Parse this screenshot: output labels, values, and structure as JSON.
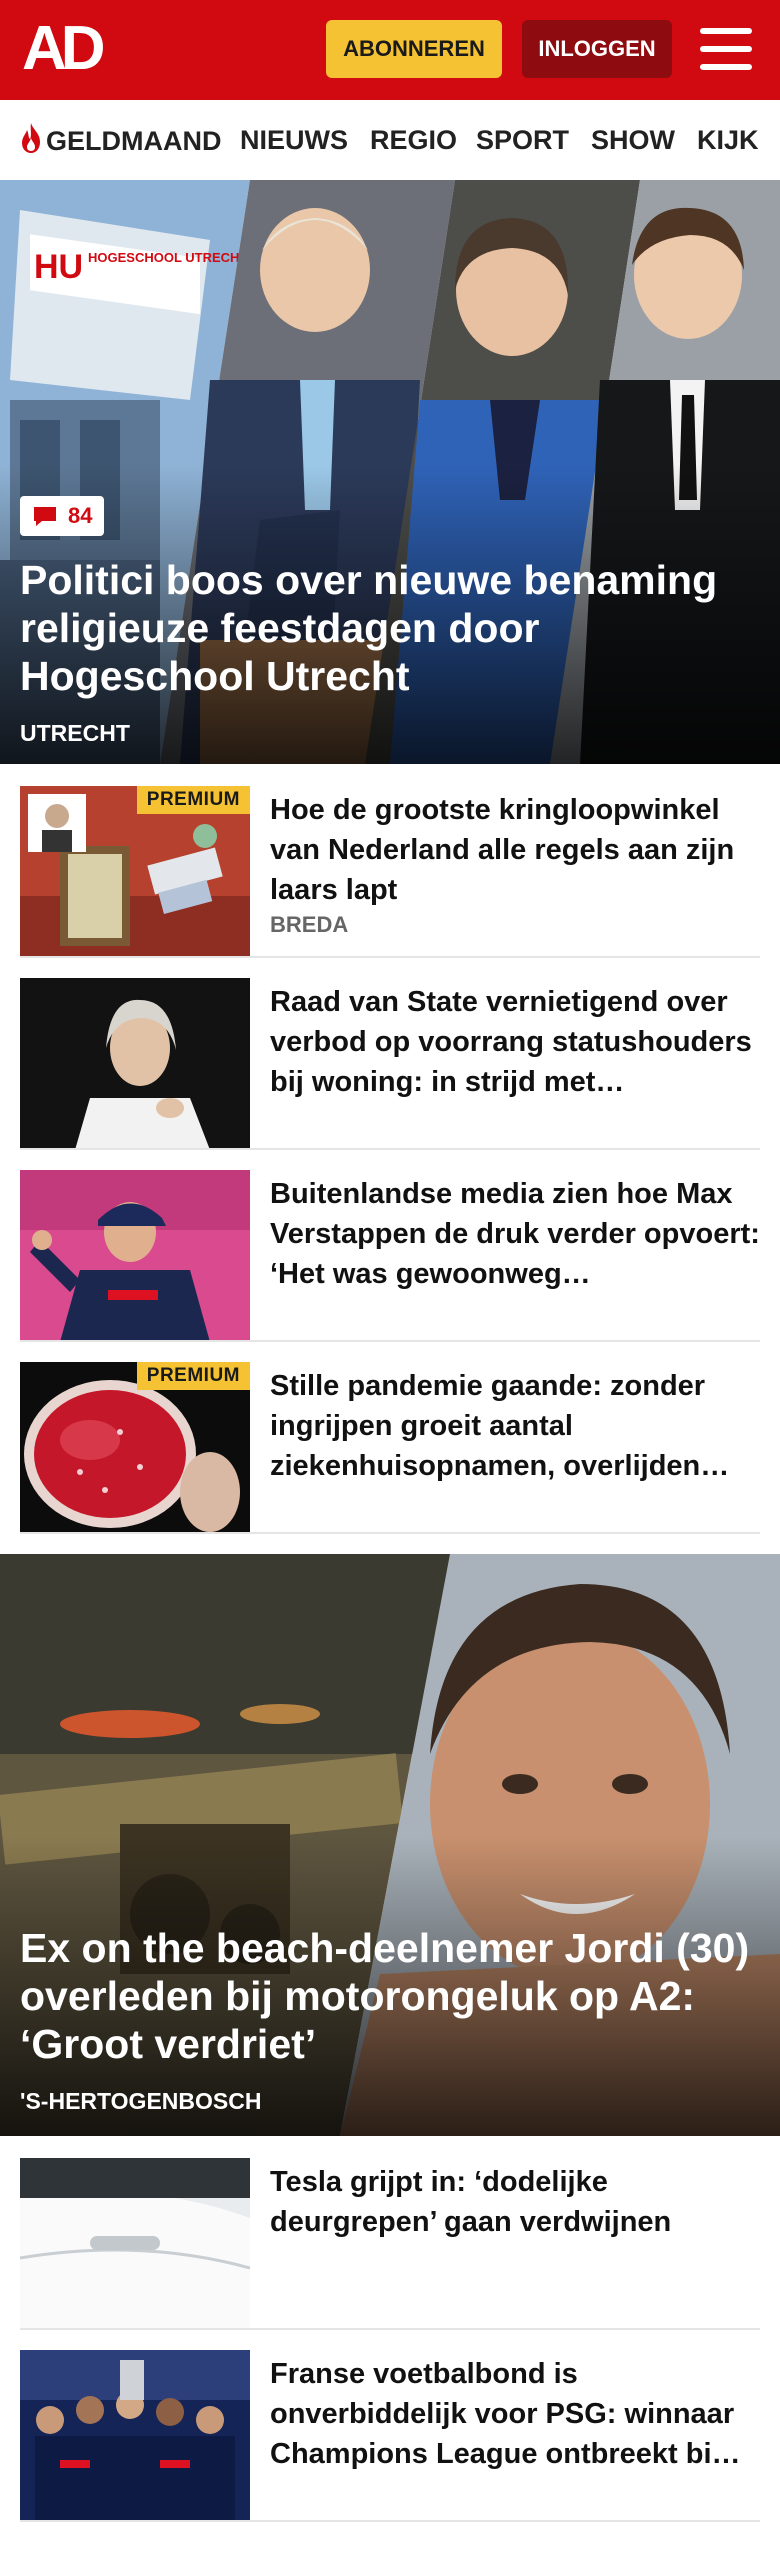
{
  "header": {
    "logo": "AD",
    "subscribe_label": "ABONNEREN",
    "login_label": "INLOGGEN"
  },
  "nav": {
    "items": [
      "GELDMAAND",
      "NIEUWS",
      "REGIO",
      "SPORT",
      "SHOW",
      "KIJK"
    ]
  },
  "hero1": {
    "comments": "84",
    "title": "Politici boos over nieuwe benaming religieuze feestdagen door Hogeschool Utrecht",
    "location": "UTRECHT",
    "sign_text": "HOGESCHOOL UTRECHT",
    "sign_logo": "HU"
  },
  "list1": [
    {
      "title": "Hoe de grootste kringloopwinkel van Nederland alle regels aan zijn laars lapt",
      "location": "BREDA",
      "badge": "PREMIUM"
    },
    {
      "title": "Raad van State vernietigend over verbod op voorrang statushou­ders bij woning: in strijd met…",
      "location": "",
      "badge": ""
    },
    {
      "title": "Buitenlandse media zien hoe Max Verstappen de druk verder opvoert: ‘Het was gewoonweg…",
      "location": "",
      "badge": ""
    },
    {
      "title": "Stille pandemie gaande: zonder ingrijpen groeit aantal ziekenhuisopnamen, overlijden…",
      "location": "",
      "badge": "PREMIUM"
    }
  ],
  "hero2": {
    "title": "Ex on the beach-deelnemer Jordi (30) overleden bij motorongeluk op A2: ‘Groot verdriet’",
    "location": "'S-HERTOGENBOSCH"
  },
  "list2": [
    {
      "title": "Tesla grijpt in: ‘dodelijke deurgrepen’ gaan verdwijnen"
    },
    {
      "title": "Franse voetbalbond is onverbiddelijk voor PSG: winnaar Champions League ontbreekt bi…"
    }
  ],
  "colors": {
    "brand_red": "#d10a11",
    "subscribe_yellow": "#f5c233",
    "login_dark_red": "#8e0c10"
  }
}
